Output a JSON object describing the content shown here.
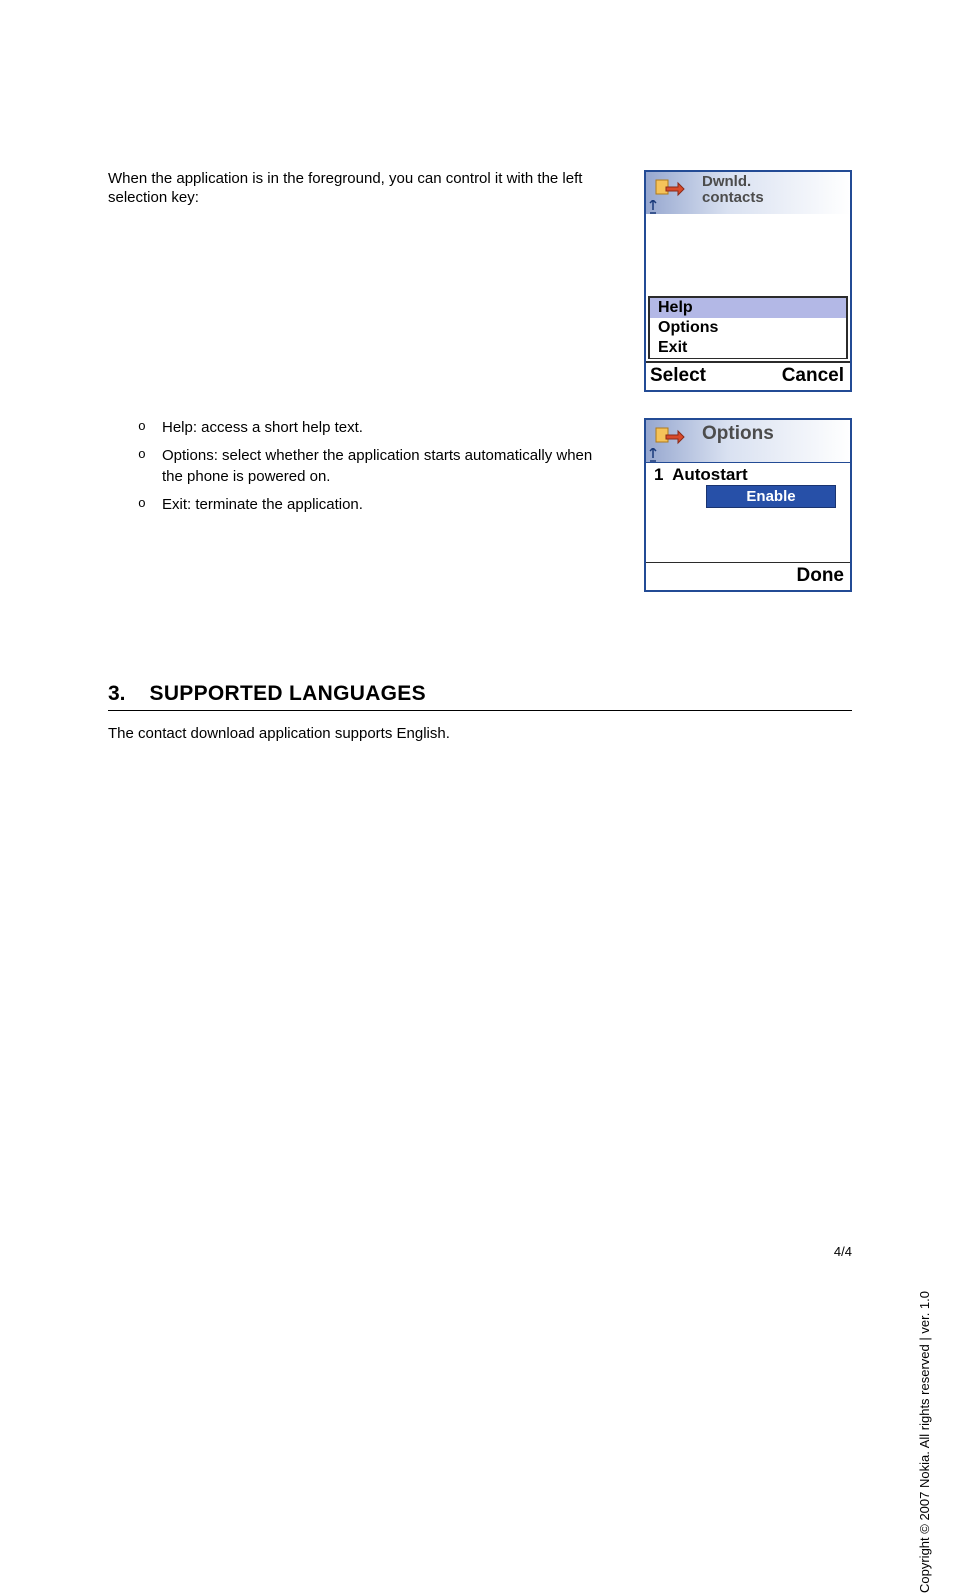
{
  "intro": "When the application is in the foreground, you can control it with the left selection key:",
  "screen1": {
    "title_line1": "Dwnld.",
    "title_line2": "contacts",
    "menu": {
      "help": "Help",
      "options": "Options",
      "exit": "Exit"
    },
    "soft_left": "Select",
    "soft_right": "Cancel"
  },
  "bullets": {
    "b1": "Help: access a short help text.",
    "b2": "Options: select whether the application starts automatically when the phone is powered on.",
    "b3": "Exit: terminate the application."
  },
  "screen2": {
    "title": "Options",
    "item_num": "1",
    "item_label": "Autostart",
    "button": "Enable",
    "soft_right": "Done"
  },
  "section": {
    "num": "3.",
    "title": "SUPPORTED LANGUAGES"
  },
  "body_after": "The contact download application supports English.",
  "page_num": "4/4",
  "copyright": "Copyright ©   2007 Nokia. All rights reserved | ver. 1.0"
}
